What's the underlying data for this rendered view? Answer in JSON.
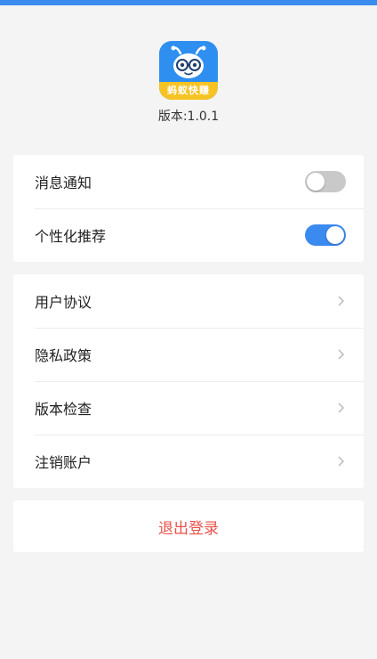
{
  "app": {
    "logo_text": "蚂蚁快赚",
    "version": "版本:1.0.1"
  },
  "settings_group": {
    "items": [
      {
        "label": "消息通知",
        "toggle_on": false
      },
      {
        "label": "个性化推荐",
        "toggle_on": true
      }
    ]
  },
  "links_group": {
    "items": [
      {
        "label": "用户协议"
      },
      {
        "label": "隐私政策"
      },
      {
        "label": "版本检查"
      },
      {
        "label": "注销账户"
      }
    ]
  },
  "logout": {
    "label": "退出登录"
  },
  "colors": {
    "accent": "#3b8af0",
    "danger": "#e9524a",
    "background": "#f4f4f4"
  },
  "icons": {
    "app_logo": "ant-mascot-logo-icon",
    "chevron": "chevron-right-icon"
  }
}
